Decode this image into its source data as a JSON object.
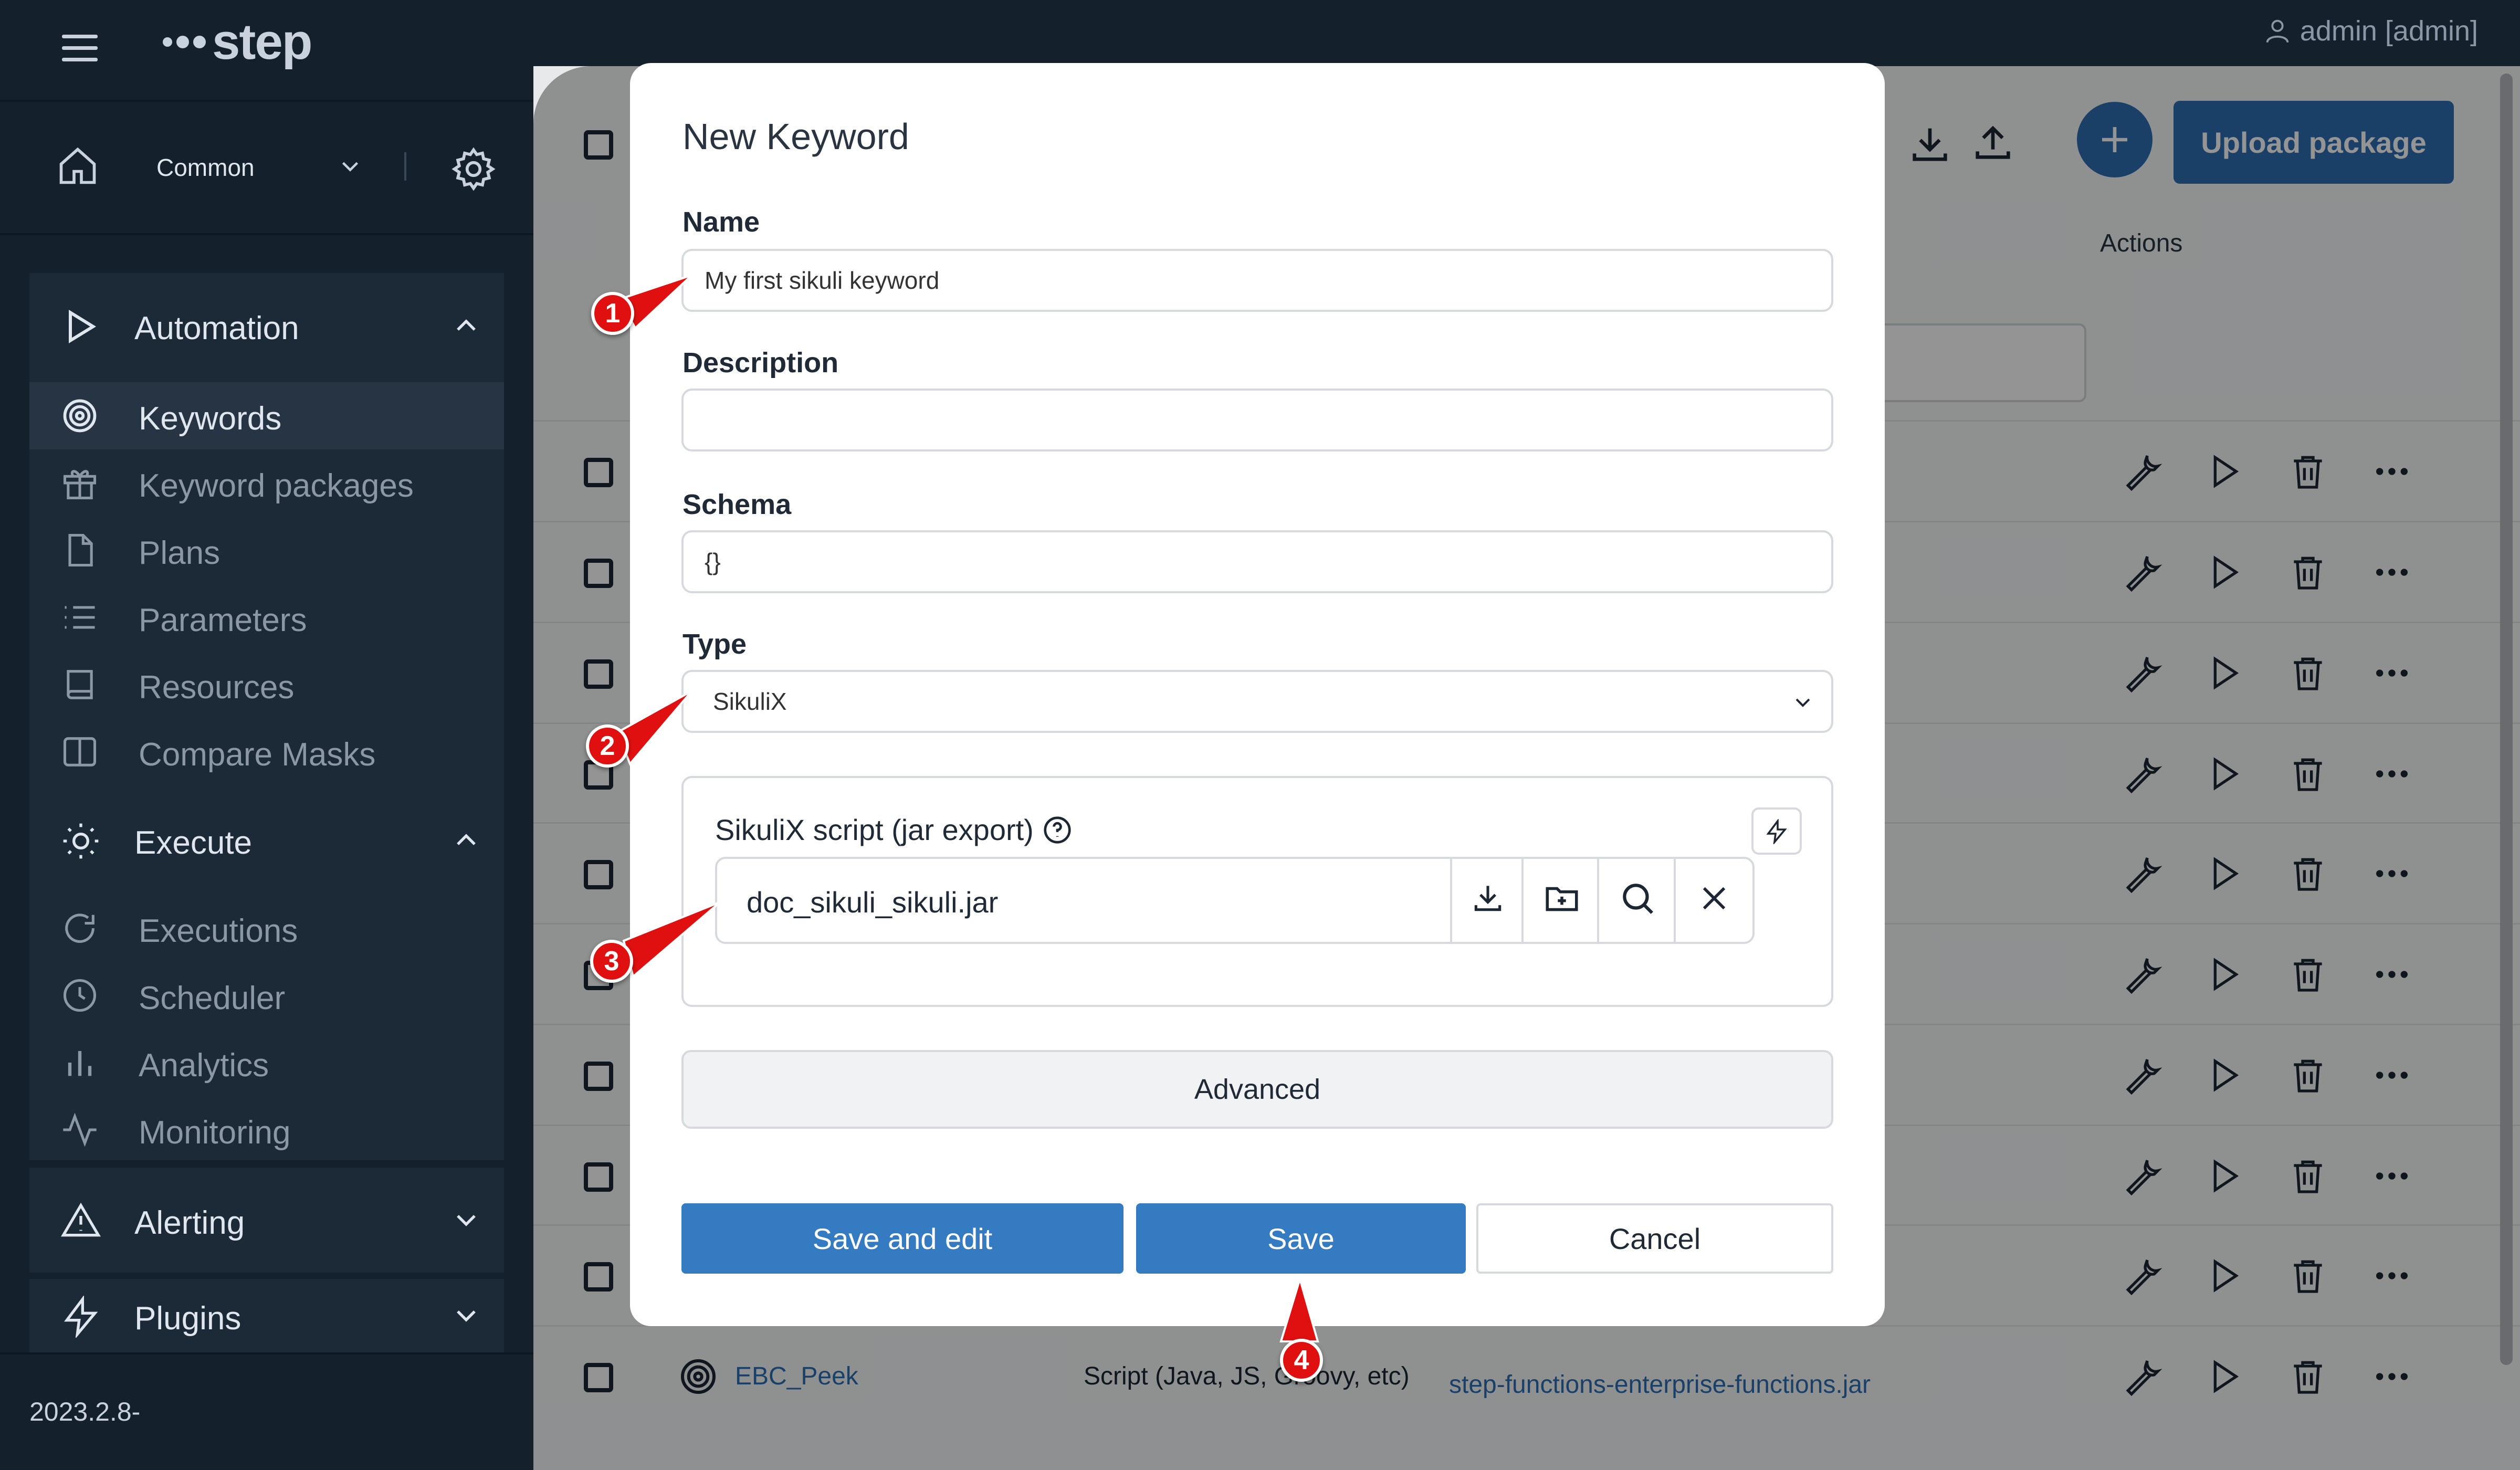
{
  "app": {
    "logo_text": "step",
    "version": "2023.2.8-"
  },
  "header": {
    "user_label": "admin [admin]"
  },
  "sidebar": {
    "tenant": "Common",
    "groups": [
      {
        "label": "Automation",
        "expanded": true,
        "items": [
          {
            "label": "Keywords",
            "icon": "keywords-icon",
            "active": true
          },
          {
            "label": "Keyword packages",
            "icon": "package-icon"
          },
          {
            "label": "Plans",
            "icon": "file-icon"
          },
          {
            "label": "Parameters",
            "icon": "list-icon"
          },
          {
            "label": "Resources",
            "icon": "book-icon"
          },
          {
            "label": "Compare Masks",
            "icon": "columns-icon"
          }
        ]
      },
      {
        "label": "Execute",
        "expanded": true,
        "items": [
          {
            "label": "Executions",
            "icon": "refresh-icon"
          },
          {
            "label": "Scheduler",
            "icon": "clock-icon"
          },
          {
            "label": "Analytics",
            "icon": "bar-chart-icon"
          },
          {
            "label": "Monitoring",
            "icon": "activity-icon"
          }
        ]
      },
      {
        "label": "Alerting",
        "expanded": false
      },
      {
        "label": "Plugins",
        "expanded": false
      }
    ]
  },
  "toolbar": {
    "upload_label": "Upload package"
  },
  "table": {
    "actions_header": "Actions",
    "visible_row": {
      "name": "EBC_Peek",
      "type": "Script (Java, JS, Groovy, etc)",
      "package": "step-functions-enterprise-functions.jar"
    }
  },
  "modal": {
    "title": "New Keyword",
    "name_label": "Name",
    "name_value": "My first sikuli keyword",
    "description_label": "Description",
    "description_value": "",
    "schema_label": "Schema",
    "schema_value": "{}",
    "type_label": "Type",
    "type_value": "SikuliX",
    "script_label": "SikuliX script (jar export)",
    "script_file": "doc_sikuli_sikuli.jar",
    "advanced_label": "Advanced",
    "save_edit_label": "Save and edit",
    "save_label": "Save",
    "cancel_label": "Cancel"
  },
  "callouts": [
    "1",
    "2",
    "3",
    "4"
  ],
  "colors": {
    "sidebar": "#15202d",
    "primary": "#357bc2",
    "callout": "#e01010"
  }
}
